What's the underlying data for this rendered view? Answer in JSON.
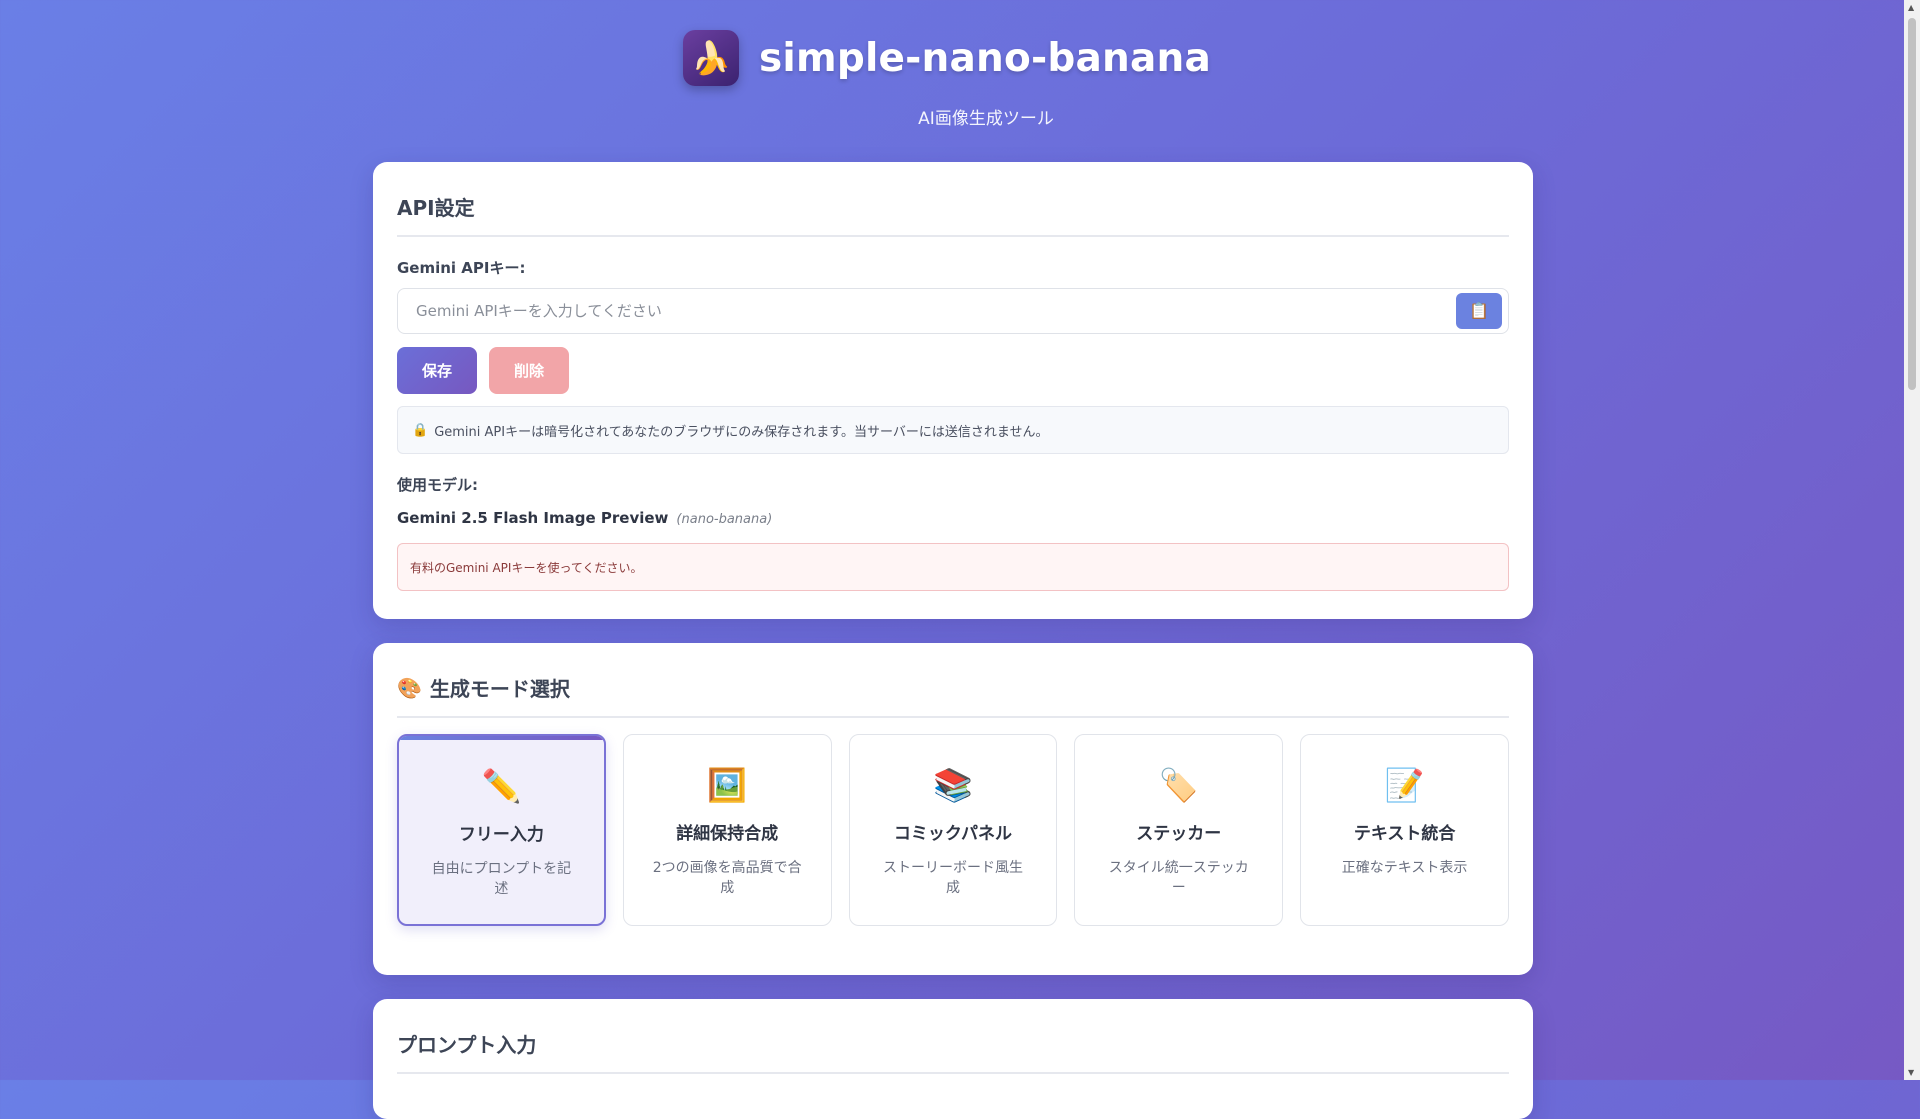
{
  "header": {
    "logo_icon": "banana-icon",
    "title": "simple-nano-banana",
    "subtitle": "AI画像生成ツール"
  },
  "api_settings": {
    "title": "API設定",
    "key_label": "Gemini APIキー:",
    "key_placeholder": "Gemini APIキーを入力してください",
    "key_value": "",
    "paste_icon": "clipboard-icon",
    "save_label": "保存",
    "delete_label": "削除",
    "notice_icon": "lock-icon",
    "notice_text": "Gemini APIキーは暗号化されてあなたのブラウザにのみ保存されます。当サーバーには送信されません。",
    "model_label": "使用モデル:",
    "model_name": "Gemini 2.5 Flash Image Preview",
    "model_alias": "(nano-banana)",
    "warning_text": "有料のGemini APIキーを使ってください。"
  },
  "mode_selection": {
    "title": "生成モード選択",
    "title_icon": "palette-icon",
    "modes": [
      {
        "name": "フリー入力",
        "desc": "自由にプロンプトを記述",
        "icon": "pencil-icon",
        "glyph": "✏️",
        "active": true
      },
      {
        "name": "詳細保持合成",
        "desc": "2つの画像を高品質で合成",
        "icon": "picture-icon",
        "glyph": "🖼️",
        "active": false
      },
      {
        "name": "コミックパネル",
        "desc": "ストーリーボード風生成",
        "icon": "books-icon",
        "glyph": "📚",
        "active": false
      },
      {
        "name": "ステッカー",
        "desc": "スタイル統一ステッカー",
        "icon": "tag-icon",
        "glyph": "🏷️",
        "active": false
      },
      {
        "name": "テキスト統合",
        "desc": "正確なテキスト表示",
        "icon": "document-icon",
        "glyph": "📝",
        "active": false
      }
    ]
  },
  "prompt_section": {
    "title": "プロンプト入力"
  },
  "colors": {
    "accent": "#6b82e0",
    "primary_button": "#6b6fd8",
    "delete_button": "#f2a5a8",
    "background_start": "#6a7fe6",
    "background_end": "#7659c4"
  }
}
